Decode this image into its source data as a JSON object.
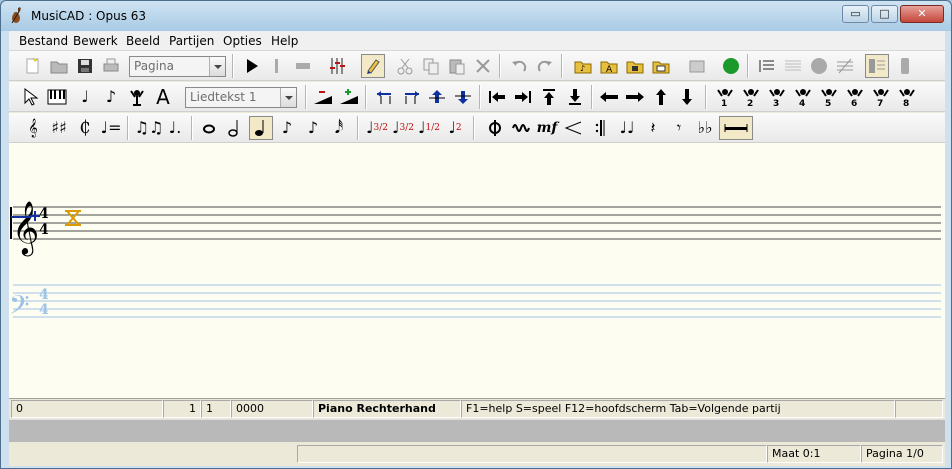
{
  "window": {
    "title": "MusiCAD : Opus 63",
    "buttons": {
      "minimize": "▭",
      "maximize": "□",
      "close": "✕"
    }
  },
  "menubar": {
    "items": [
      "Bestand",
      "Bewerk",
      "Beeld",
      "Partijen",
      "Opties",
      "Help"
    ]
  },
  "toolbar1": {
    "page_combo": "Pagina"
  },
  "toolbar2": {
    "lyrics_combo": "Liedtekst 1"
  },
  "toolbar3": {
    "tuplets": [
      "3/2",
      "3/2",
      "1/2",
      "2"
    ]
  },
  "score": {
    "time_signature": "4/4"
  },
  "status": {
    "position": "0",
    "bar": "1",
    "beat": "1",
    "tick": "0000",
    "part": "Piano Rechterhand",
    "help": "F1=help S=speel F12=hoofdscherm Tab=Volgende partij"
  },
  "bottom": {
    "maat": "Maat 0:1",
    "pagina": "Pagina 1/0"
  },
  "colors": {
    "score_background": "#fefdf2",
    "accent_blue": "#1030a0",
    "record_green": "#1a9a2a",
    "staff_light": "#9cc2e6"
  }
}
